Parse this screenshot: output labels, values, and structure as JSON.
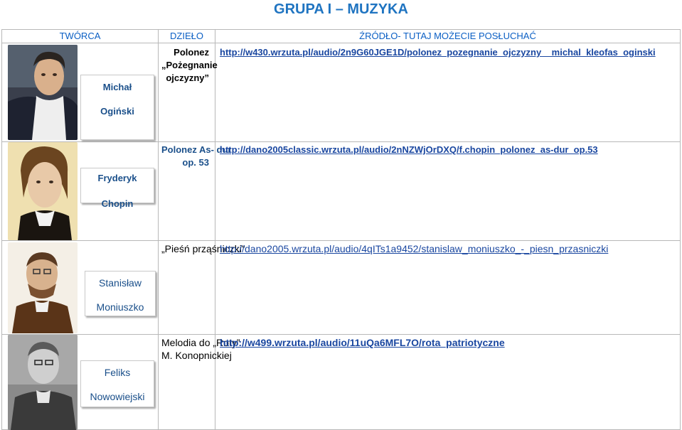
{
  "page": {
    "title": "GRUPA I – MUZYKA",
    "title_color": "#1f74c1"
  },
  "header": {
    "col1": "TWÓRCA",
    "col2": "DZIEŁO",
    "col3": "ŹRÓDŁO- TUTAJ MOŻECIE POSŁUCHAĆ",
    "color": "#0b5fc4"
  },
  "colors": {
    "name_text": "#1a4f8a",
    "link_text": "#1a47a0"
  },
  "rows": [
    {
      "first_name": "Michał",
      "last_name": "Ogiński",
      "work_lines": [
        "Polonez",
        "„Pożegnanie",
        "ojczyzny”"
      ],
      "url": "http://w430.wrzuta.pl/audio/2n9G60JGE1D/polonez_pozegnanie_ojczyzny__michal_kleofas_oginski",
      "portrait_icon": "portrait-oginski"
    },
    {
      "first_name": "Fryderyk",
      "last_name": "Chopin",
      "work_lines": [
        "Polonez As- dur",
        "op. 53"
      ],
      "url": "http://dano2005classic.wrzuta.pl/audio/2nNZWjOrDXQ/f.chopin_polonez_as-dur_op.53",
      "portrait_icon": "portrait-chopin"
    },
    {
      "first_name": "Stanisław",
      "last_name": "Moniuszko",
      "work_lines": [
        "„Pieśń prząśniczki”"
      ],
      "url": "http://dano2005.wrzuta.pl/audio/4qITs1a9452/stanislaw_moniuszko_-_piesn_przasniczki",
      "portrait_icon": "portrait-moniuszko"
    },
    {
      "first_name": "Feliks",
      "last_name": "Nowowiejski",
      "work_lines": [
        "Melodia do „Roty”",
        "M. Konopnickiej"
      ],
      "url": "http://w499.wrzuta.pl/audio/11uQa6MFL7O/rota_patriotyczne",
      "portrait_icon": "portrait-nowowiejski"
    }
  ]
}
